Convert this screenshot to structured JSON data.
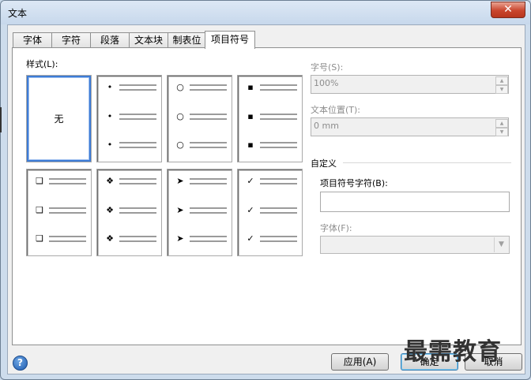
{
  "window": {
    "title": "文本",
    "close_icon": "close-icon"
  },
  "tabs": [
    {
      "label": "字体"
    },
    {
      "label": "字符"
    },
    {
      "label": "段落"
    },
    {
      "label": "文本块"
    },
    {
      "label": "制表位"
    },
    {
      "label": "项目符号",
      "active": true
    }
  ],
  "style": {
    "label": "样式(L):",
    "none_label": "无",
    "cells": [
      {
        "name": "none",
        "symbol": ""
      },
      {
        "name": "filled-dot",
        "symbol": "•"
      },
      {
        "name": "hollow-circle",
        "symbol": "○"
      },
      {
        "name": "small-square",
        "symbol": "▪"
      },
      {
        "name": "hollow-square",
        "symbol": "❑"
      },
      {
        "name": "diamond-cluster",
        "symbol": "❖"
      },
      {
        "name": "arrowhead",
        "symbol": "➤"
      },
      {
        "name": "check",
        "symbol": "✓"
      }
    ],
    "selected": "none"
  },
  "size": {
    "label": "字号(S):",
    "value": "100%"
  },
  "position": {
    "label": "文本位置(T):",
    "value": "0 mm"
  },
  "custom": {
    "section_label": "自定义",
    "char_label": "项目符号字符(B):",
    "char_value": "",
    "font_label": "字体(F):",
    "font_value": ""
  },
  "buttons": {
    "apply": "应用(A)",
    "ok": "确定",
    "cancel": "取消"
  },
  "watermark": "最需教育"
}
